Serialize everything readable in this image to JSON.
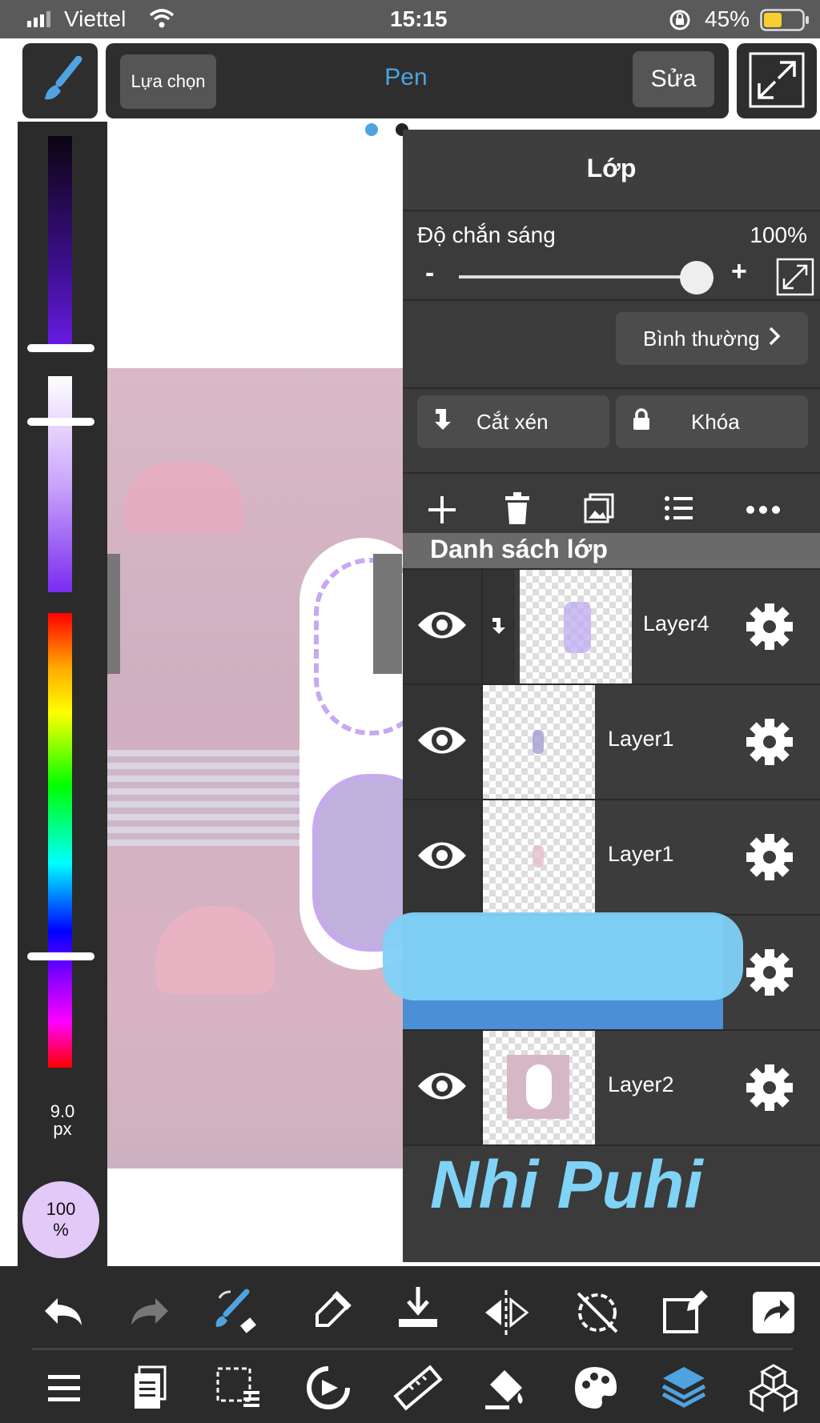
{
  "status_bar": {
    "carrier": "Viettel",
    "time": "15:15",
    "battery": "45%",
    "battery_level": 0.45,
    "signal_icon": "signal-bars-icon",
    "wifi_icon": "wifi-icon",
    "lock_icon": "rotation-lock-icon",
    "battery_icon": "battery-icon"
  },
  "toolbar": {
    "brush_icon": "brush-icon",
    "select_label": "Lựa chọn",
    "tool_name": "Pen",
    "edit_label": "Sửa",
    "expand_icon": "expand-icon"
  },
  "colors": {
    "accent": "#4fa3e0",
    "panel": "#3b3b3b",
    "dark": "#2b2b2b",
    "brush_size_bg": "#e2c9f7"
  },
  "color_panel": {
    "brush_size": "9.0",
    "brush_unit": "px",
    "opacity_value": "100",
    "opacity_unit": "%"
  },
  "layer_panel": {
    "title": "Lớp",
    "opacity_label": "Độ chắn sáng",
    "opacity_value": "100%",
    "opacity_level": 1.0,
    "minus_label": "-",
    "plus_label": "+",
    "blend_mode": "Bình thường",
    "clip_label": "Cắt xén",
    "lock_label": "Khóa",
    "list_header": "Danh sách lớp",
    "action_icons": [
      "add-layer-icon",
      "delete-layer-icon",
      "image-layer-icon",
      "layer-list-icon",
      "more-icon"
    ],
    "layers": [
      {
        "name": "Layer4",
        "clipped": true
      },
      {
        "name": "Layer1",
        "clipped": false
      },
      {
        "name": "Layer1",
        "clipped": false
      },
      {
        "name": "",
        "clipped": false
      },
      {
        "name": "Layer2",
        "clipped": false
      }
    ],
    "signature": "Nhi Puhi"
  },
  "bottom_toolbar_row1": [
    "undo-icon",
    "redo-icon",
    "brush-eraser-swap-icon",
    "eyedropper-icon",
    "download-icon",
    "flip-icon",
    "rotate-off-icon",
    "transform-icon",
    "share-icon"
  ],
  "bottom_toolbar_row2": [
    "menu-icon",
    "pages-icon",
    "selection-icon",
    "rotate-canvas-icon",
    "ruler-icon",
    "fill-icon",
    "palette-icon",
    "layers-icon",
    "materials-icon"
  ]
}
